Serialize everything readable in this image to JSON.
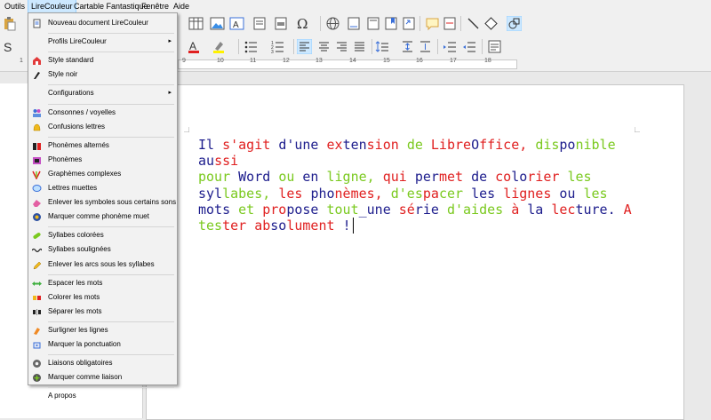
{
  "menubar": {
    "items": [
      "Outils",
      "LireCouleur",
      "Cartable Fantastique",
      "Fenêtre",
      "Aide"
    ],
    "active": "LireCouleur"
  },
  "menu": {
    "items": [
      {
        "label": "Nouveau document LireCouleur",
        "icon": "document-icon"
      },
      {
        "sep": true
      },
      {
        "label": "Profils LireCouleur",
        "icon": "",
        "submenu": true
      },
      {
        "sep": true
      },
      {
        "label": "Style standard",
        "icon": "house-icon"
      },
      {
        "label": "Style noir",
        "icon": "brush-icon"
      },
      {
        "sep": true
      },
      {
        "label": "Configurations",
        "icon": "",
        "submenu": true
      },
      {
        "sep": true
      },
      {
        "label": "Consonnes / voyelles",
        "icon": "people-icon"
      },
      {
        "label": "Confusions lettres",
        "icon": "bell-icon"
      },
      {
        "sep": true
      },
      {
        "label": "Phonèmes alternés",
        "icon": "phoneme-alt-icon"
      },
      {
        "label": "Phonèmes",
        "icon": "phoneme-icon"
      },
      {
        "label": "Graphèmes complexes",
        "icon": "grapheme-icon"
      },
      {
        "label": "Lettres muettes",
        "icon": "speech-bubble-icon"
      },
      {
        "label": "Enlever les symboles sous certains sons",
        "icon": "eraser-icon"
      },
      {
        "label": "Marquer comme phonème muet",
        "icon": "mute-icon"
      },
      {
        "sep": true
      },
      {
        "label": "Syllabes colorées",
        "icon": "pill-icon"
      },
      {
        "label": "Syllabes soulignées",
        "icon": "wave-icon"
      },
      {
        "label": "Enlever les arcs sous les syllabes",
        "icon": "pencil-icon"
      },
      {
        "sep": true
      },
      {
        "label": "Espacer les mots",
        "icon": "double-arrow-icon"
      },
      {
        "label": "Colorer les mots",
        "icon": "color-words-icon"
      },
      {
        "label": "Séparer les mots",
        "icon": "separate-icon"
      },
      {
        "sep": true
      },
      {
        "label": "Surligner les lignes",
        "icon": "highlighter-icon"
      },
      {
        "label": "Marquer la ponctuation",
        "icon": "punctuation-icon"
      },
      {
        "sep": true
      },
      {
        "label": "Liaisons obligatoires",
        "icon": "gear-icon"
      },
      {
        "label": "Marquer comme liaison",
        "icon": "star-gear-icon"
      },
      {
        "sep": true
      },
      {
        "label": "A propos",
        "icon": ""
      }
    ]
  },
  "ruler": {
    "numbers": [
      "1",
      "9",
      "10",
      "11",
      "12",
      "13",
      "14",
      "15",
      "16",
      "17",
      "18"
    ]
  },
  "document": {
    "words": [
      [
        "Il",
        "blue"
      ],
      [
        " ",
        ""
      ],
      [
        "s'",
        "red"
      ],
      [
        "agit",
        "red"
      ],
      [
        " ",
        ""
      ],
      [
        "d'",
        "blue"
      ],
      [
        "une",
        "blue"
      ],
      [
        " ",
        ""
      ],
      [
        "ex",
        "red"
      ],
      [
        "ten",
        "blue"
      ],
      [
        "sion",
        "red"
      ],
      [
        " ",
        ""
      ],
      [
        "de",
        "green"
      ],
      [
        " ",
        ""
      ],
      [
        "Libre",
        "red"
      ],
      [
        "O",
        "blue"
      ],
      [
        "ffice,",
        "red"
      ],
      [
        " ",
        ""
      ],
      [
        "dis",
        "green"
      ],
      [
        "po",
        "blue"
      ],
      [
        "nible",
        "green"
      ],
      [
        " ",
        ""
      ],
      [
        "au",
        "blue"
      ],
      [
        "ssi",
        "red"
      ],
      [
        "\n",
        ""
      ],
      [
        "pour",
        "green"
      ],
      [
        " ",
        ""
      ],
      [
        "Word",
        "blue"
      ],
      [
        " ",
        ""
      ],
      [
        "ou",
        "green"
      ],
      [
        " ",
        ""
      ],
      [
        "en",
        "blue"
      ],
      [
        " ",
        ""
      ],
      [
        "ligne,",
        "green"
      ],
      [
        " ",
        ""
      ],
      [
        "qui",
        "red"
      ],
      [
        " ",
        ""
      ],
      [
        "per",
        "blue"
      ],
      [
        "met",
        "red"
      ],
      [
        " ",
        ""
      ],
      [
        "de",
        "blue"
      ],
      [
        " ",
        ""
      ],
      [
        "co",
        "red"
      ],
      [
        "lo",
        "blue"
      ],
      [
        "rier",
        "red"
      ],
      [
        " ",
        ""
      ],
      [
        "les",
        "green"
      ],
      [
        "\n",
        ""
      ],
      [
        "syl",
        "blue"
      ],
      [
        "labes,",
        "green"
      ],
      [
        " ",
        ""
      ],
      [
        "les",
        "red"
      ],
      [
        " ",
        ""
      ],
      [
        "pho",
        "blue"
      ],
      [
        "nèmes,",
        "red"
      ],
      [
        " ",
        ""
      ],
      [
        "d'es",
        "green"
      ],
      [
        "pa",
        "red"
      ],
      [
        "cer",
        "green"
      ],
      [
        " ",
        ""
      ],
      [
        "les",
        "blue"
      ],
      [
        " ",
        ""
      ],
      [
        "lignes",
        "red"
      ],
      [
        " ",
        ""
      ],
      [
        "ou",
        "blue"
      ],
      [
        " ",
        ""
      ],
      [
        "les",
        "green"
      ],
      [
        "\n",
        ""
      ],
      [
        "mots",
        "blue"
      ],
      [
        " ",
        ""
      ],
      [
        "et",
        "green"
      ],
      [
        " ",
        ""
      ],
      [
        "pro",
        "red"
      ],
      [
        "pose",
        "blue"
      ],
      [
        " ",
        ""
      ],
      [
        "tout",
        "green"
      ],
      [
        "_",
        "blue"
      ],
      [
        "une",
        "blue"
      ],
      [
        " ",
        ""
      ],
      [
        "sé",
        "red"
      ],
      [
        "rie",
        "blue"
      ],
      [
        " ",
        ""
      ],
      [
        "d'aides",
        "green"
      ],
      [
        " ",
        ""
      ],
      [
        "à",
        "red"
      ],
      [
        " ",
        ""
      ],
      [
        "la",
        "blue"
      ],
      [
        " ",
        ""
      ],
      [
        "lec",
        "red"
      ],
      [
        "ture.",
        "blue"
      ],
      [
        " ",
        ""
      ],
      [
        "A",
        "red"
      ],
      [
        "\n",
        ""
      ],
      [
        "tes",
        "green"
      ],
      [
        "ter",
        "red"
      ],
      [
        " ",
        ""
      ],
      [
        "ab",
        "red"
      ],
      [
        "so",
        "blue"
      ],
      [
        "lu",
        "red"
      ],
      [
        "ment",
        "red"
      ],
      [
        " ",
        ""
      ],
      [
        "!",
        "blue"
      ]
    ]
  }
}
